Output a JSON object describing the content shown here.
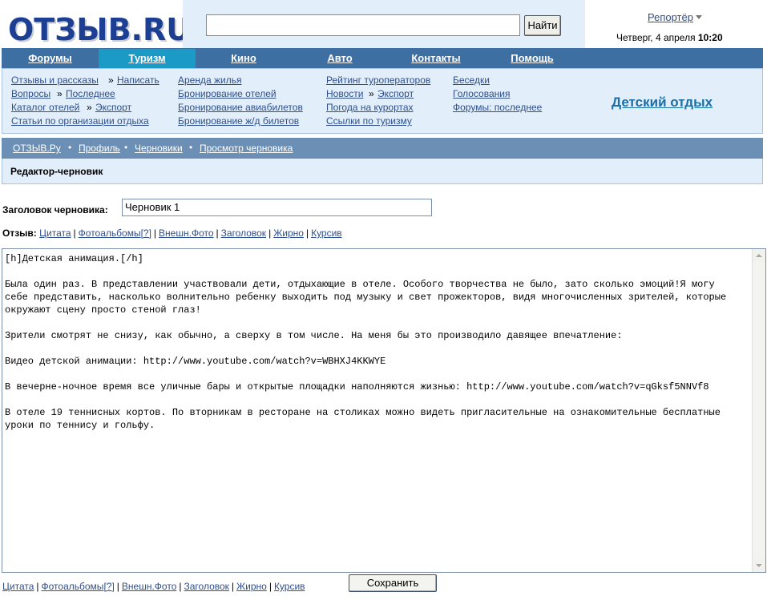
{
  "header": {
    "logo": "ОТЗЫВ.RU",
    "search_button": "Найти",
    "search_value": "",
    "reporter": "Репортёр",
    "date_prefix": "Четверг, 4 апреля",
    "time": "10:20"
  },
  "nav": {
    "items": [
      "Форумы",
      "Туризм",
      "Кино",
      "Авто",
      "Контакты",
      "Помощь"
    ],
    "active": "Туризм"
  },
  "submenu": {
    "col1": [
      "Отзывы и рассказы",
      "Написать",
      "Вопросы",
      "Последнее",
      "Каталог отелей",
      "Экспорт",
      "Статьи по организации отдыха"
    ],
    "col2": [
      "Аренда жилья",
      "Бронирование отелей",
      "Бронирование авиабилетов",
      "Бронирование ж/д билетов"
    ],
    "col3": [
      "Рейтинг туроператоров",
      "Новости",
      "Экспорт",
      "Погода на курортах",
      "Ссылки по туризму"
    ],
    "col4": [
      "Беседки",
      "Голосования",
      "Форумы: последнее"
    ],
    "separator": "»",
    "highlight": "Детский отдых"
  },
  "breadcrumb": [
    "ОТЗЫВ.Ру",
    "Профиль",
    "Черновики",
    "Просмотр черновика"
  ],
  "page_title": "Редактор-черновик",
  "form": {
    "title_label": "Заголовок черновика:",
    "title_value": "Черновик 1",
    "review_label": "Отзыв:",
    "tools": [
      "Цитата",
      "Фотоальбомы",
      "[?]",
      "Внешн.Фото",
      "Заголовок",
      "Жирно",
      "Курсив"
    ],
    "editor_text": "[h]Детская анимация.[/h]\n\nБыла один раз. В представлении участвовали дети, отдыхающие в отеле. Особого творчества не было, зато сколько эмоций!Я могу себе представить, насколько волнительно ребенку выходить под музыку и свет прожекторов, видя многочисленных зрителей, которые окружают сцену просто стеной глаз!\n\nЗрители смотрят не снизу, как обычно, а сверху в том числе. На меня бы это производило давящее впечатление:\n\nВидео детской анимации: http://www.youtube.com/watch?v=WBHXJ4KKWYE\n\nВ вечерне-ночное время все уличные бары и открытые площадки наполняются жизнью: http://www.youtube.com/watch?v=qGksf5NNVf8\n\nВ отеле 19 теннисных кортов. По вторникам в ресторане на столиках можно видеть пригласительные на ознакомительные бесплатные уроки по теннису и гольфу.",
    "save_button": "Сохранить"
  },
  "colors": {
    "nav_bg": "#3e6fa2",
    "nav_active": "#1b9ac6",
    "panel_bg": "#e2effb",
    "crumb_bg": "#6c8fb5",
    "link": "#2f4f8c",
    "logo": "#1c3f94"
  }
}
